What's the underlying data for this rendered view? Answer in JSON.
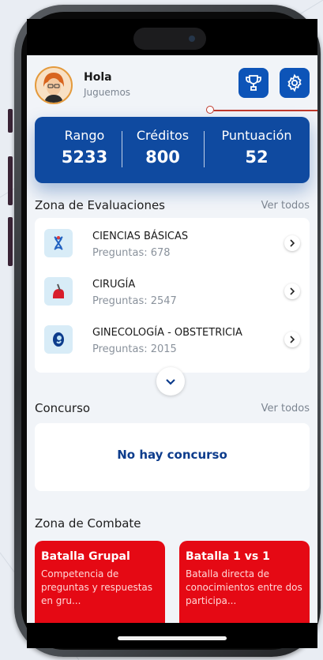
{
  "header": {
    "greeting": "Hola",
    "subtitle": "Juguemos"
  },
  "stats": [
    {
      "label": "Rango",
      "value": "5233"
    },
    {
      "label": "Créditos",
      "value": "800"
    },
    {
      "label": "Puntuación",
      "value": "52"
    }
  ],
  "evaluations": {
    "title": "Zona de Evaluaciones",
    "see_all": "Ver todos",
    "items": [
      {
        "name": "CIENCIAS BÁSICAS",
        "count": "Preguntas: 678",
        "icon": "dna-icon"
      },
      {
        "name": "CIRUGÍA",
        "count": "Preguntas: 2547",
        "icon": "scalpel-icon"
      },
      {
        "name": "GINECOLOGÍA - OBSTETRICIA",
        "count": "Preguntas: 2015",
        "icon": "fetus-icon"
      }
    ]
  },
  "contest": {
    "title": "Concurso",
    "see_all": "Ver todos",
    "empty": "No hay concurso"
  },
  "combat": {
    "title": "Zona de Combate",
    "cards": [
      {
        "title": "Batalla Grupal",
        "desc": "Competencia de preguntas y respuestas en gru..."
      },
      {
        "title": "Batalla 1 vs 1",
        "desc": "Batalla directa de conocimientos entre dos participa..."
      }
    ]
  },
  "colors": {
    "primary": "#0f4aa0",
    "battle": "#e50914",
    "background": "#f1f4f8"
  }
}
